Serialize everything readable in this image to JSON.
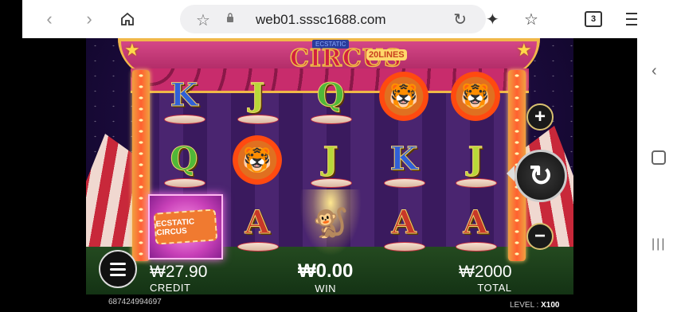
{
  "browser": {
    "url": "web01.sssc1688.com",
    "tab_count": "3",
    "icons": [
      "back-icon",
      "forward-icon",
      "home-icon",
      "bookmark-star-icon",
      "lock-icon",
      "reload-icon",
      "sparkle-icon",
      "favorites-icon",
      "tabs-icon",
      "menu-icon"
    ]
  },
  "game": {
    "logo": {
      "ecstatic": "ECSTATIC",
      "circus": "CIRCUS",
      "lines": "20LINES"
    },
    "reels": [
      [
        "K",
        "Q",
        "ticket"
      ],
      [
        "J",
        "tiger",
        "A"
      ],
      [
        "Q",
        "J",
        "monkey"
      ],
      [
        "tiger",
        "K",
        "A"
      ],
      [
        "tiger",
        "J",
        "A"
      ]
    ],
    "ticket_text": "ECSTATIC CIRCUS",
    "credit": {
      "value": "₩27.90",
      "label": "CREDIT"
    },
    "win": {
      "value": "₩0.00",
      "label": "WIN"
    },
    "total": {
      "value": "₩2000",
      "label": "TOTAL"
    },
    "account_id": "687424994697",
    "level": {
      "label": "LEVEL :",
      "value": "X100"
    }
  },
  "colors": {
    "accent_gold": "#f0c048",
    "curtain_pink": "#c82c6c"
  }
}
